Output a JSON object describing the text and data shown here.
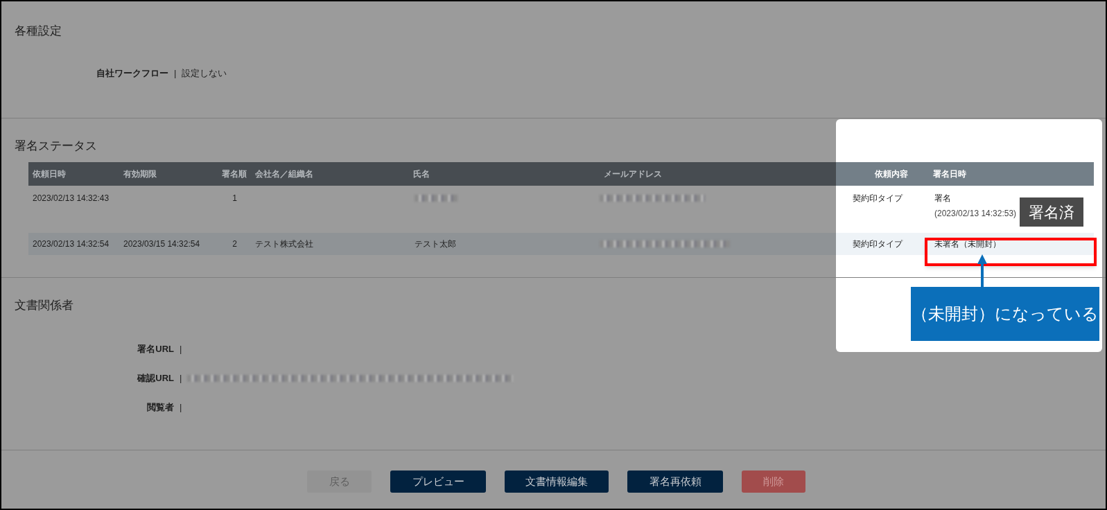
{
  "settings": {
    "title": "各種設定",
    "fields": [
      {
        "label": "自社ワークフロー",
        "separator": "|",
        "value": "設定しない"
      }
    ]
  },
  "signature_status": {
    "title": "署名ステータス",
    "columns": [
      "依頼日時",
      "有効期限",
      "署名順",
      "会社名／組織名",
      "氏名",
      "メールアドレス",
      "依頼内容",
      "署名日時"
    ],
    "rows": [
      {
        "requested_at": "2023/02/13 14:32:43",
        "order": "1",
        "name_redacted": true,
        "email_redacted": true,
        "request_type": "契約印タイプ",
        "status": "署名",
        "signed_at": "(2023/02/13 14:32:53)"
      },
      {
        "requested_at": "2023/02/13 14:32:54",
        "expires_at": "2023/03/15 14:32:54",
        "order": "2",
        "company": "テスト株式会社",
        "name": "テスト太郎",
        "email_redacted": true,
        "request_type": "契約印タイプ",
        "status": "未署名（未開封）"
      }
    ]
  },
  "document_parties": {
    "title": "文書関係者",
    "fields": [
      {
        "label": "署名URL",
        "separator": "|",
        "value_redacted": false
      },
      {
        "label": "確認URL",
        "separator": "|",
        "value_redacted": true
      },
      {
        "label": "閲覧者",
        "separator": "|",
        "value_redacted": false
      }
    ]
  },
  "buttons": [
    {
      "label": "戻る",
      "kind": "back"
    },
    {
      "label": "プレビュー",
      "kind": "primary"
    },
    {
      "label": "文書情報編集",
      "kind": "primary"
    },
    {
      "label": "署名再依頼",
      "kind": "primary"
    },
    {
      "label": "削除",
      "kind": "danger"
    }
  ],
  "annotations": {
    "badge": "署名済",
    "callout": "（未開封）になっている"
  }
}
